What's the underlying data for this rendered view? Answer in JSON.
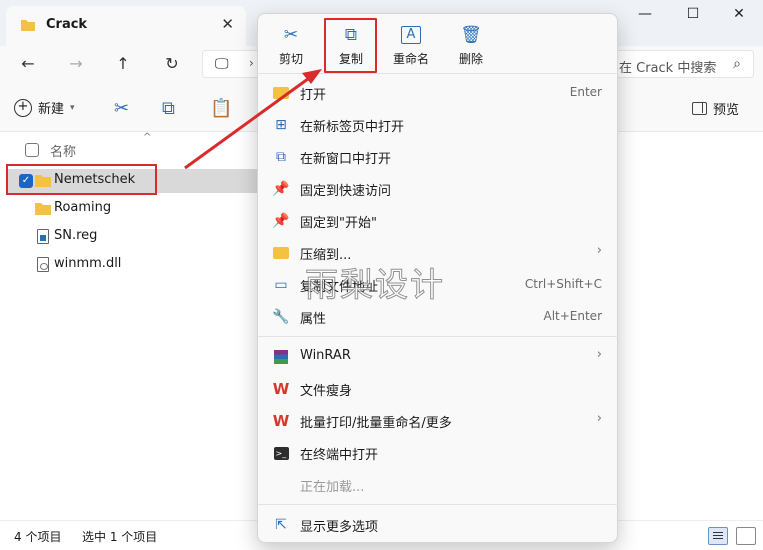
{
  "window": {
    "tab_title": "Crack",
    "tab_close": "✕",
    "minimize": "—",
    "maximize": "☐",
    "close": "✕"
  },
  "address": {
    "search_placeholder": "在 Crack 中搜索"
  },
  "toolbar": {
    "new_label": "新建",
    "preview_label": "预览"
  },
  "file_list": {
    "column_name": "名称",
    "items": [
      {
        "name": "Nemetschek",
        "type": "folder",
        "selected": true
      },
      {
        "name": "Roaming",
        "type": "folder",
        "selected": false
      },
      {
        "name": "SN.reg",
        "type": "reg",
        "selected": false
      },
      {
        "name": "winmm.dll",
        "type": "dll",
        "selected": false
      }
    ]
  },
  "status": {
    "item_count": "4 个项目",
    "selected_count": "选中 1 个项目"
  },
  "context_menu": {
    "quick_actions": [
      {
        "label": "剪切",
        "icon": "scissors-icon"
      },
      {
        "label": "复制",
        "icon": "copy-icon"
      },
      {
        "label": "重命名",
        "icon": "rename-icon"
      },
      {
        "label": "删除",
        "icon": "trash-icon"
      }
    ],
    "items": [
      {
        "label": "打开",
        "shortcut": "Enter"
      },
      {
        "label": "在新标签页中打开"
      },
      {
        "label": "在新窗口中打开"
      },
      {
        "label": "固定到快速访问"
      },
      {
        "label": "固定到\"开始\""
      },
      {
        "label": "压缩到..."
      },
      {
        "label": "复制文件地址",
        "shortcut": "Ctrl+Shift+C"
      },
      {
        "label": "属性",
        "shortcut": "Alt+Enter"
      },
      {
        "label": "WinRAR"
      },
      {
        "label": "文件瘦身"
      },
      {
        "label": "批量打印/批量重命名/更多"
      },
      {
        "label": "在终端中打开"
      },
      {
        "label": "正在加载..."
      },
      {
        "label": "显示更多选项"
      }
    ]
  },
  "watermark": "雨梨设计",
  "colors": {
    "accent": "#2a6fb6",
    "highlight": "#d92b2b",
    "folder": "#f4c143"
  }
}
